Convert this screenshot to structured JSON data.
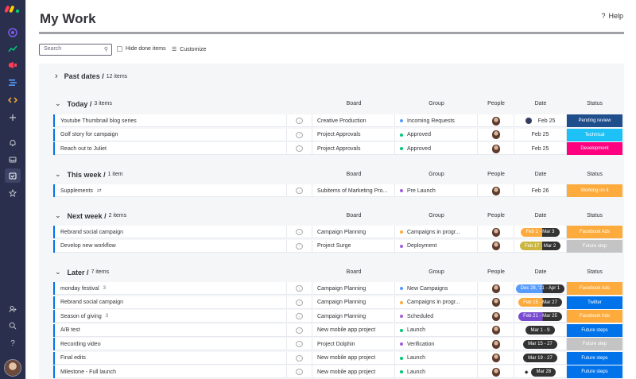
{
  "colors": {
    "sidebar": "#292f4c",
    "accent": "#0073ea"
  },
  "header": {
    "title": "My Work",
    "help_label": "Help"
  },
  "toolbar": {
    "search_placeholder": "Search",
    "hide_done_label": "Hide done items",
    "customize_label": "Customize"
  },
  "columns": {
    "board": "Board",
    "group": "Group",
    "people": "People",
    "date": "Date",
    "status": "Status"
  },
  "sections": {
    "past": {
      "title": "Past dates /",
      "count": "12 items"
    },
    "today": {
      "title": "Today /",
      "count": "3 items",
      "rows": [
        {
          "name": "Youtube Thumbnail blog series",
          "board": "Creative Production",
          "group": "Incoming Requests",
          "group_color": "#579bfc",
          "date": "Feb 25",
          "status": "Pending review",
          "status_color": "#1f4e8c"
        },
        {
          "name": "Golf story for campaign",
          "board": "Project Approvals",
          "group": "Approved",
          "group_color": "#00c875",
          "date": "Feb 25",
          "status": "Technical",
          "status_color": "#1ec1f5"
        },
        {
          "name": "Reach out to Juliet",
          "board": "Project Approvals",
          "group": "Approved",
          "group_color": "#00c875",
          "date": "Feb 25",
          "status": "Development",
          "status_color": "#ff007f"
        }
      ]
    },
    "week": {
      "title": "This week /",
      "count": "1 item",
      "rows": [
        {
          "name": "Supplements",
          "board": "Subitems of Marketing Pro...",
          "group": "Pre Launch",
          "group_color": "#a25ddc",
          "date": "Feb 26",
          "status": "Working on it",
          "status_color": "#fdab3d"
        }
      ]
    },
    "next": {
      "title": "Next week /",
      "count": "2 items",
      "rows": [
        {
          "name": "Rebrand social campaign",
          "board": "Campaign Planning",
          "group": "Campaigns in progr...",
          "group_color": "#fdab3d",
          "date": "Feb 1 - Mar 3",
          "date_color": "#fdab3d",
          "status": "Facebook Ads",
          "status_color": "#fdab3d"
        },
        {
          "name": "Develop new workflow",
          "board": "Project Surge",
          "group": "Deployment",
          "group_color": "#a25ddc",
          "date": "Feb 17 - Mar 2",
          "date_color": "#cab641",
          "status": "Future step",
          "status_color": "#c4c4c4"
        }
      ]
    },
    "later": {
      "title": "Later /",
      "count": "7 items",
      "rows": [
        {
          "name": "monday festival",
          "badge": "3",
          "board": "Campaign Planning",
          "group": "New Campaigns",
          "group_color": "#579bfc",
          "date": "Dec 28, '21 - Apr 1",
          "date_color": "#579bfc",
          "status": "Facebook Ads",
          "status_color": "#fdab3d"
        },
        {
          "name": "Rebrand social campaign",
          "board": "Campaign Planning",
          "group": "Campaigns in progr...",
          "group_color": "#fdab3d",
          "date": "Feb 15 - Mar 27",
          "date_color": "#fdab3d",
          "status": "Twitter",
          "status_color": "#0073ea"
        },
        {
          "name": "Season of giving",
          "badge": "3",
          "board": "Campaign Planning",
          "group": "Scheduled",
          "group_color": "#a25ddc",
          "date": "Feb 21 - Mar 25",
          "date_color": "#784bd1",
          "status": "Facebook Ads",
          "status_color": "#fdab3d"
        },
        {
          "name": "A/B test",
          "board": "New mobile app project",
          "group": "Launch",
          "group_color": "#00c875",
          "date": "Mar 1 - 9",
          "date_color": "#333333",
          "status": "Future steps",
          "status_color": "#0073ea"
        },
        {
          "name": "Recording video",
          "board": "Project Dolphin",
          "group": "Verification",
          "group_color": "#a25ddc",
          "date": "Mar 15 - 27",
          "date_color": "#333333",
          "status": "Future step",
          "status_color": "#c4c4c4"
        },
        {
          "name": "Final edits",
          "board": "New mobile app project",
          "group": "Launch",
          "group_color": "#00c875",
          "date": "Mar 19 - 27",
          "date_color": "#333333",
          "status": "Future steps",
          "status_color": "#0073ea"
        },
        {
          "name": "Milestone - Full launch",
          "board": "New mobile app project",
          "group": "Launch",
          "group_color": "#00c875",
          "date": "Mar 28",
          "date_color": "#333333",
          "status": "Future steps",
          "status_color": "#0073ea"
        }
      ]
    }
  }
}
